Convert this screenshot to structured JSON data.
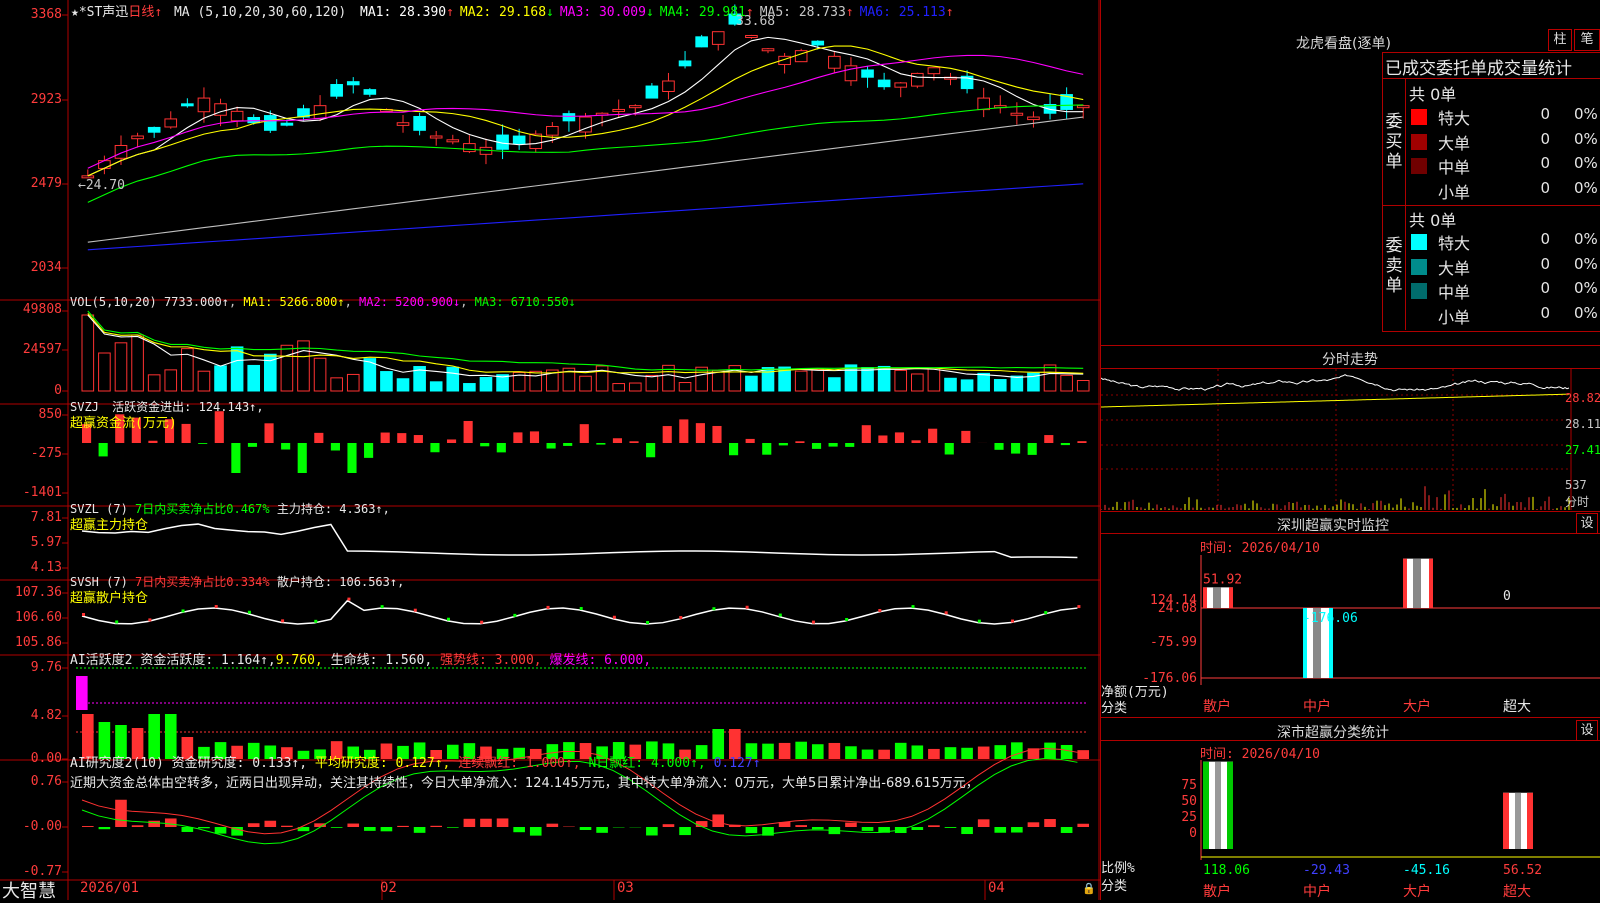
{
  "main": {
    "title": "★*ST声迅",
    "period": "日线",
    "ma_header": "MA (5,10,20,30,60,120)",
    "ma_values": [
      {
        "label": "MA1: 28.390",
        "arrow": "↑",
        "color": "#ffffff"
      },
      {
        "label": "MA2: 29.168",
        "arrow": "↓",
        "color": "#ffff00"
      },
      {
        "label": "MA3: 30.009",
        "arrow": "↓",
        "color": "#ff00ff"
      },
      {
        "label": "MA4: 29.981",
        "arrow": "↑",
        "color": "#00ff00"
      },
      {
        "label": "MA5: 28.733",
        "arrow": "↑",
        "color": "#c8c8c8"
      },
      {
        "label": "MA6: 25.113",
        "arrow": "↑",
        "color": "#2020ff"
      }
    ],
    "y_axis": [
      "3368",
      "2923",
      "2479",
      "2034"
    ],
    "high_note": "33.68",
    "low_note": "←24.70",
    "colors": {
      "up": "#ff3232",
      "down": "#00ffff",
      "ma1": "#ffffff",
      "ma2": "#ffff00",
      "ma3": "#ff00ff",
      "ma4": "#00ff00",
      "ma5": "#c0c0c0",
      "ma6": "#2020ff"
    }
  },
  "vol": {
    "label": "VOL(5,10,20)",
    "value": "7733.000↑",
    "ma1": "MA1: 5266.800↑",
    "ma2": "MA2: 5200.900↓",
    "ma3": "MA3: 6710.550↓",
    "y_axis": [
      "49808",
      "24597",
      "0"
    ]
  },
  "svzj": {
    "label": "SVZJ",
    "text": "活跃资金进出: 124.143↑,",
    "sub": "超赢资金流(万元)",
    "y_axis": [
      "850",
      "-275",
      "-1401"
    ]
  },
  "svzl": {
    "label": "SVZL (7)",
    "text1": "7日内买卖净占比0.467%",
    "text2": "主力持仓: 4.363↑,",
    "sub": "超赢主力持仓",
    "y_axis": [
      "7.81",
      "5.97",
      "4.13"
    ]
  },
  "svsh": {
    "label": "SVSH (7)",
    "text1": "7日内买卖净占比0.334%",
    "text2": "散户持仓: 106.563↑,",
    "sub": "超赢散户持仓",
    "y_axis": [
      "107.36",
      "106.60",
      "105.86"
    ]
  },
  "ai1": {
    "label": "AI活跃度2",
    "t1": "资金活跃度: 1.164↑,",
    "t2": "9.760,",
    "t3": "生命线: 1.560,",
    "t4": "强势线: 3.000,",
    "t5": "爆发线: 6.000,",
    "y_axis": [
      "9.76",
      "4.82",
      "0.00"
    ]
  },
  "ai2": {
    "label": "AI研究度2(10)",
    "t1": "资金研究度: 0.133↑,",
    "t2": "平均研究度: 0.127↑,",
    "t3": "连续飘红: 1.000↑,",
    "t4": "N日飘红: 4.000↑,",
    "t5": "0.127↑",
    "note": "近期大资金总体由空转多，近两日出现异动，关注其持续性，今日大单净流入：124.145万元，其中特大单净流入：0万元，大单5日累计净出-689.615万元，",
    "y_axis": [
      "0.76",
      "-0.00",
      "-0.77"
    ]
  },
  "bottom": {
    "brand": "大智慧",
    "dates": [
      "2026/01",
      "02",
      "03",
      "04"
    ]
  },
  "right": {
    "dragon_title": "龙虎看盘(逐单)",
    "btn_zhu": "柱",
    "btn_bi": "笔",
    "order_header": "已成交委托单成交量统计",
    "buy_label": "委买单",
    "sell_label": "委卖单",
    "buy_total": "共 0单",
    "sell_total": "共 0单",
    "buy_rows": [
      {
        "name": "特大",
        "val": "0",
        "pct": "0%",
        "color": "#ff0000"
      },
      {
        "name": "大单",
        "val": "0",
        "pct": "0%",
        "color": "#a00000"
      },
      {
        "name": "中单",
        "val": "0",
        "pct": "0%",
        "color": "#700000"
      },
      {
        "name": "小单",
        "val": "0",
        "pct": "0%",
        "color": ""
      }
    ],
    "sell_rows": [
      {
        "name": "特大",
        "val": "0",
        "pct": "0%",
        "color": "#00ffff"
      },
      {
        "name": "大单",
        "val": "0",
        "pct": "0%",
        "color": "#008c8c"
      },
      {
        "name": "中单",
        "val": "0",
        "pct": "0%",
        "color": "#006c6c"
      },
      {
        "name": "小单",
        "val": "0",
        "pct": "0%",
        "color": ""
      }
    ],
    "intraday_title": "分时走势",
    "intraday_axis": [
      "28.82",
      "28.11",
      "27.41"
    ],
    "intraday_vol": [
      "537",
      "分时"
    ],
    "monitor_title": "深圳超赢实时监控",
    "monitor_btn": "设",
    "monitor_time": "时间: 2026/04/10",
    "monitor_axis": [
      "124.14",
      "24.08",
      "-75.99",
      "-176.06"
    ],
    "monitor_unit": "净额(万元)",
    "monitor_cat_label": "分类",
    "monitor_values": [
      "51.92",
      "-176.06",
      "124.14",
      "0"
    ],
    "monitor_cats": [
      "散户",
      "中户",
      "大户",
      "超大"
    ],
    "stats_title": "深市超赢分类统计",
    "stats_btn": "设",
    "stats_time": "时间: 2026/04/10",
    "stats_axis": [
      "75",
      "50",
      "25",
      "0"
    ],
    "stats_unit": "比例%",
    "stats_cat_label": "分类",
    "stats_values": [
      "118.06",
      "-29.43",
      "-45.16",
      "56.52"
    ],
    "stats_cats": [
      "散户",
      "中户",
      "大户",
      "超大"
    ]
  }
}
